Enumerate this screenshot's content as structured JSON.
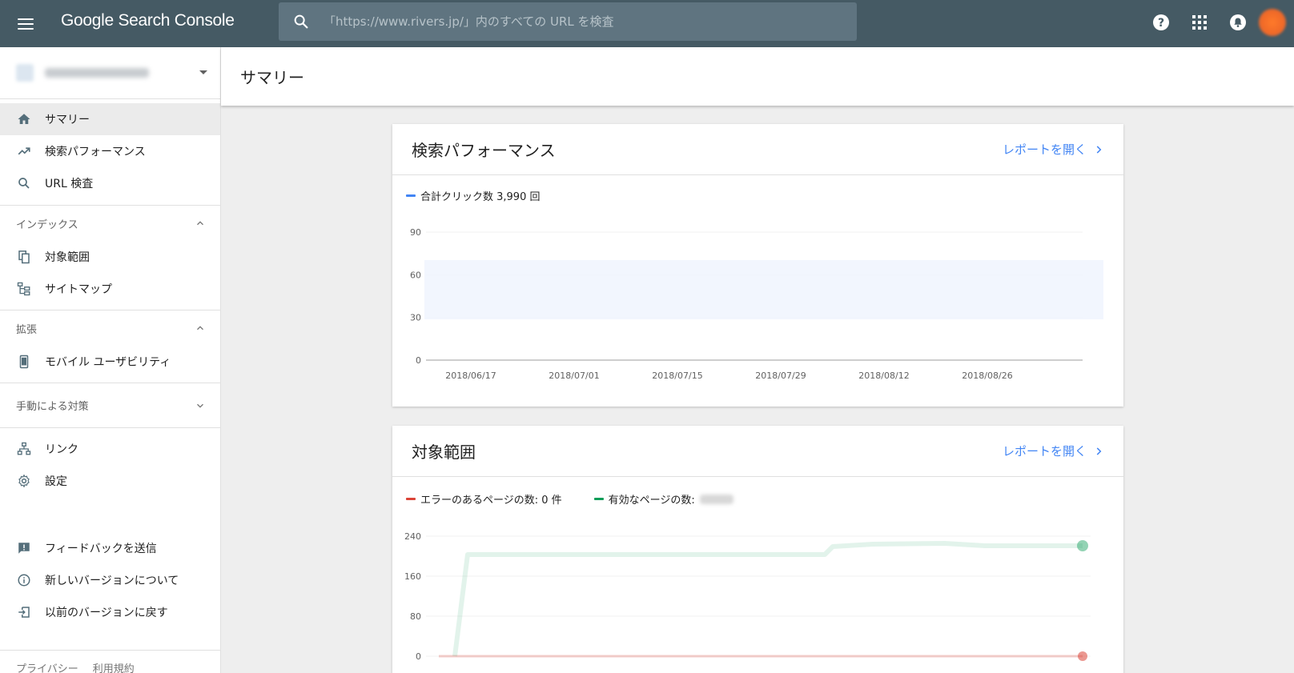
{
  "app": {
    "logo_text": "Google Search Console",
    "search_placeholder": "「https://www.rivers.jp/」内のすべての URL を検査"
  },
  "sidebar": {
    "nav_main": [
      {
        "label": "サマリー",
        "icon": "home-icon",
        "active": true
      },
      {
        "label": "検索パフォーマンス",
        "icon": "trending-up-icon",
        "active": false
      },
      {
        "label": "URL 検査",
        "icon": "search-icon",
        "active": false
      }
    ],
    "index_section": {
      "title": "インデックス",
      "items": [
        {
          "label": "対象範囲",
          "icon": "copy-pages-icon"
        },
        {
          "label": "サイトマップ",
          "icon": "sitemap-icon"
        }
      ]
    },
    "enhancements_section": {
      "title": "拡張",
      "items": [
        {
          "label": "モバイル ユーザビリティ",
          "icon": "smartphone-icon"
        }
      ]
    },
    "manual_actions_section": {
      "title": "手動による対策"
    },
    "other_items": [
      {
        "label": "リンク",
        "icon": "links-icon"
      },
      {
        "label": "設定",
        "icon": "gear-icon"
      }
    ],
    "bottom_items": [
      {
        "label": "フィードバックを送信",
        "icon": "feedback-icon"
      },
      {
        "label": "新しいバージョンについて",
        "icon": "info-icon"
      },
      {
        "label": "以前のバージョンに戻す",
        "icon": "exit-icon"
      }
    ],
    "footer": {
      "privacy": "プライバシー",
      "terms": "利用規約"
    }
  },
  "main": {
    "page_title": "サマリー",
    "performance_card": {
      "title": "検索パフォーマンス",
      "open_label": "レポートを開く",
      "legend_label": "合計クリック数 3,990 回",
      "color": "#4285f4"
    },
    "coverage_card": {
      "title": "対象範囲",
      "open_label": "レポートを開く",
      "legend_error": "エラーのあるページの数: 0 件",
      "legend_valid": "有効なページの数:",
      "error_color": "#db4437",
      "valid_color": "#0f9d58"
    }
  },
  "chart_data": [
    {
      "type": "line",
      "series": [
        {
          "name": "合計クリック数",
          "color": "#4285f4",
          "values": []
        }
      ],
      "x_tick_labels": [
        "2018/06/17",
        "2018/07/01",
        "2018/07/15",
        "2018/07/29",
        "2018/08/12",
        "2018/08/26"
      ],
      "y_tick_labels": [
        "90",
        "60",
        "30",
        "0"
      ],
      "ylim": [
        0,
        90
      ]
    },
    {
      "type": "line",
      "series": [
        {
          "name": "エラーのあるページの数",
          "color": "#db4437",
          "values": [
            0,
            0,
            0,
            0,
            0
          ]
        },
        {
          "name": "有効なページの数",
          "color": "#0f9d58",
          "values": []
        }
      ],
      "y_tick_labels": [
        "240",
        "160",
        "80",
        "0"
      ],
      "ylim": [
        0,
        240
      ]
    }
  ]
}
